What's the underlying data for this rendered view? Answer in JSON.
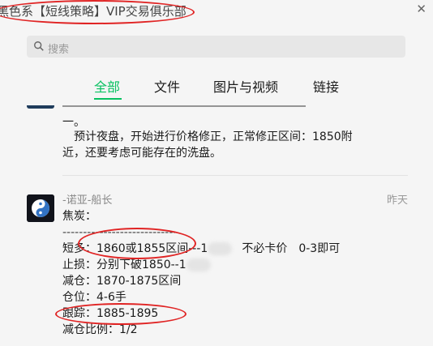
{
  "window": {
    "title": "黑色系【短线策略】VIP交易俱乐部",
    "close_icon": "✕"
  },
  "search": {
    "placeholder": "搜索"
  },
  "tabs": [
    {
      "label": "全部",
      "active": true
    },
    {
      "label": "文件",
      "active": false
    },
    {
      "label": "图片与视频",
      "active": false
    },
    {
      "label": "链接",
      "active": false
    }
  ],
  "messages": {
    "previous": {
      "line_partial": "一。",
      "line2": "　预计夜盘，开始进行价格修正，正常修正区间：1850附",
      "line3": "近，还要考虑可能存在的洗盘。"
    },
    "current": {
      "sender": "-诺亚-船长",
      "time": "昨天",
      "lines": [
        "焦炭：",
        "----------------------------",
        "短多：1860或1855区间---1",
        "不必卡价　0-3即可",
        "止损：分别下破1850--1",
        "减仓：1870-1875区间",
        "仓位：4-6手",
        "跟踪：1885-1895",
        "减仓比例：1/2"
      ]
    }
  },
  "colors": {
    "accent": "#07c160",
    "annotation": "#e02424"
  },
  "icons": {
    "search": "search-icon",
    "avatar": "yin-yang-icon"
  }
}
